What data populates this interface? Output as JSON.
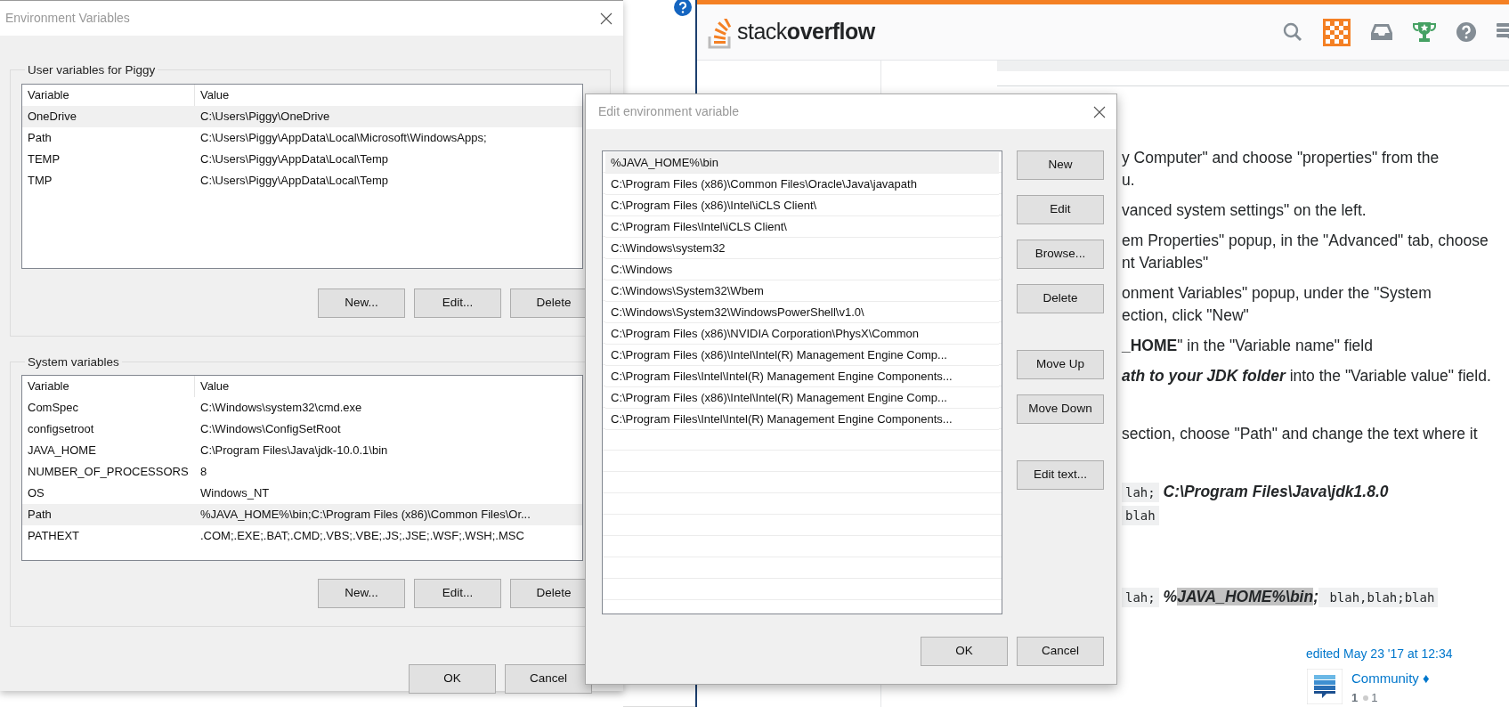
{
  "env_dialog": {
    "title": "Environment Variables",
    "user_group": {
      "label": "User variables for Piggy",
      "columns": [
        "Variable",
        "Value"
      ],
      "rows": [
        {
          "variable": "OneDrive",
          "value": "C:\\Users\\Piggy\\OneDrive",
          "selected": true
        },
        {
          "variable": "Path",
          "value": "C:\\Users\\Piggy\\AppData\\Local\\Microsoft\\WindowsApps;",
          "selected": false
        },
        {
          "variable": "TEMP",
          "value": "C:\\Users\\Piggy\\AppData\\Local\\Temp",
          "selected": false
        },
        {
          "variable": "TMP",
          "value": "C:\\Users\\Piggy\\AppData\\Local\\Temp",
          "selected": false
        }
      ],
      "buttons": [
        "New...",
        "Edit...",
        "Delete"
      ]
    },
    "system_group": {
      "label": "System variables",
      "columns": [
        "Variable",
        "Value"
      ],
      "rows": [
        {
          "variable": "ComSpec",
          "value": "C:\\Windows\\system32\\cmd.exe",
          "selected": false
        },
        {
          "variable": "configsetroot",
          "value": "C:\\Windows\\ConfigSetRoot",
          "selected": false
        },
        {
          "variable": "JAVA_HOME",
          "value": "C:\\Program Files\\Java\\jdk-10.0.1\\bin",
          "selected": false
        },
        {
          "variable": "NUMBER_OF_PROCESSORS",
          "value": "8",
          "selected": false
        },
        {
          "variable": "OS",
          "value": "Windows_NT",
          "selected": false
        },
        {
          "variable": "Path",
          "value": "%JAVA_HOME%\\bin;C:\\Program Files (x86)\\Common Files\\Or...",
          "selected": true
        },
        {
          "variable": "PATHEXT",
          "value": ".COM;.EXE;.BAT;.CMD;.VBS;.VBE;.JS;.JSE;.WSF;.WSH;.MSC",
          "selected": false
        }
      ],
      "buttons": [
        "New...",
        "Edit...",
        "Delete"
      ]
    },
    "buttons": [
      "OK",
      "Cancel"
    ]
  },
  "browser": {
    "logo": "stack**overflow**",
    "blocks": [
      {
        "kind": "step",
        "lines": [
          [
            {
              "kind": "plain",
              "text": "y Computer\" and choose \"properties\" from the"
            }
          ],
          [
            {
              "kind": "plain",
              "text": "u."
            }
          ]
        ]
      },
      {
        "kind": "step",
        "lines": [
          [
            {
              "kind": "plain",
              "text": "vanced system settings\" on the left."
            }
          ]
        ]
      },
      {
        "kind": "step",
        "lines": [
          [
            {
              "kind": "plain",
              "text": "em Properties\" popup, in the \"Advanced\" tab, choose"
            }
          ],
          [
            {
              "kind": "plain",
              "text": "nt Variables\""
            }
          ]
        ]
      },
      {
        "kind": "step",
        "lines": [
          [
            {
              "kind": "plain",
              "text": "onment Variables\" popup, under the \"System"
            }
          ],
          [
            {
              "kind": "plain",
              "text": "ection, click \"New\""
            }
          ]
        ]
      },
      {
        "kind": "step",
        "lines": [
          [
            {
              "kind": "bold",
              "text": "_HOME"
            },
            {
              "kind": "plain",
              "text": "\" in the \"Variable name\" field"
            }
          ]
        ]
      },
      {
        "kind": "step",
        "lines": [
          [
            {
              "kind": "bolditalic",
              "text": "ath to your JDK folder"
            },
            {
              "kind": "plain",
              "text": " into the \"Variable value\" field."
            }
          ]
        ]
      },
      {
        "kind": "gap",
        "lines": [
          [
            {
              "kind": "plain",
              "text": "section, choose \"Path\" and change the text where it"
            }
          ]
        ]
      },
      {
        "kind": "gap",
        "lines": [
          [
            {
              "kind": "code",
              "text": "lah;"
            },
            {
              "kind": "bolditalic",
              "text": " C:\\Program Files\\Java\\jdk1.8.0"
            }
          ],
          [
            {
              "kind": "code",
              "text": "blah"
            }
          ]
        ]
      },
      {
        "kind": "gap",
        "lines": [
          [
            {
              "kind": "code",
              "text": "lah;"
            },
            {
              "kind": "bolditalic",
              "text": " %"
            },
            {
              "kind": "selection",
              "text": "JAVA_HOME%\\bin"
            },
            {
              "kind": "bolditalic",
              "text": ";"
            },
            {
              "kind": "code",
              "text": " blah,blah;blah"
            }
          ]
        ]
      }
    ],
    "edited": "edited May 23 '17 at 12:34",
    "user": {
      "name": "Community ♦",
      "reputation": "1",
      "bronze": "1"
    }
  },
  "edit_dialog": {
    "title": "Edit environment variable",
    "items": [
      {
        "text": "%JAVA_HOME%\\bin",
        "selected": true
      },
      {
        "text": "C:\\Program Files (x86)\\Common Files\\Oracle\\Java\\javapath",
        "selected": false
      },
      {
        "text": "C:\\Program Files (x86)\\Intel\\iCLS Client\\",
        "selected": false
      },
      {
        "text": "C:\\Program Files\\Intel\\iCLS Client\\",
        "selected": false
      },
      {
        "text": "C:\\Windows\\system32",
        "selected": false
      },
      {
        "text": "C:\\Windows",
        "selected": false
      },
      {
        "text": "C:\\Windows\\System32\\Wbem",
        "selected": false
      },
      {
        "text": "C:\\Windows\\System32\\WindowsPowerShell\\v1.0\\",
        "selected": false
      },
      {
        "text": "C:\\Program Files (x86)\\NVIDIA Corporation\\PhysX\\Common",
        "selected": false
      },
      {
        "text": "C:\\Program Files (x86)\\Intel\\Intel(R) Management Engine Comp...",
        "selected": false
      },
      {
        "text": "C:\\Program Files\\Intel\\Intel(R) Management Engine Components...",
        "selected": false
      },
      {
        "text": "C:\\Program Files (x86)\\Intel\\Intel(R) Management Engine Comp...",
        "selected": false
      },
      {
        "text": "C:\\Program Files\\Intel\\Intel(R) Management Engine Components...",
        "selected": false
      }
    ],
    "button_groups": [
      [
        "New",
        "Edit",
        "Browse...",
        "Delete"
      ],
      [
        "Move Up",
        "Move Down"
      ],
      [
        "Edit text..."
      ]
    ],
    "buttons": [
      "OK",
      "Cancel"
    ]
  }
}
